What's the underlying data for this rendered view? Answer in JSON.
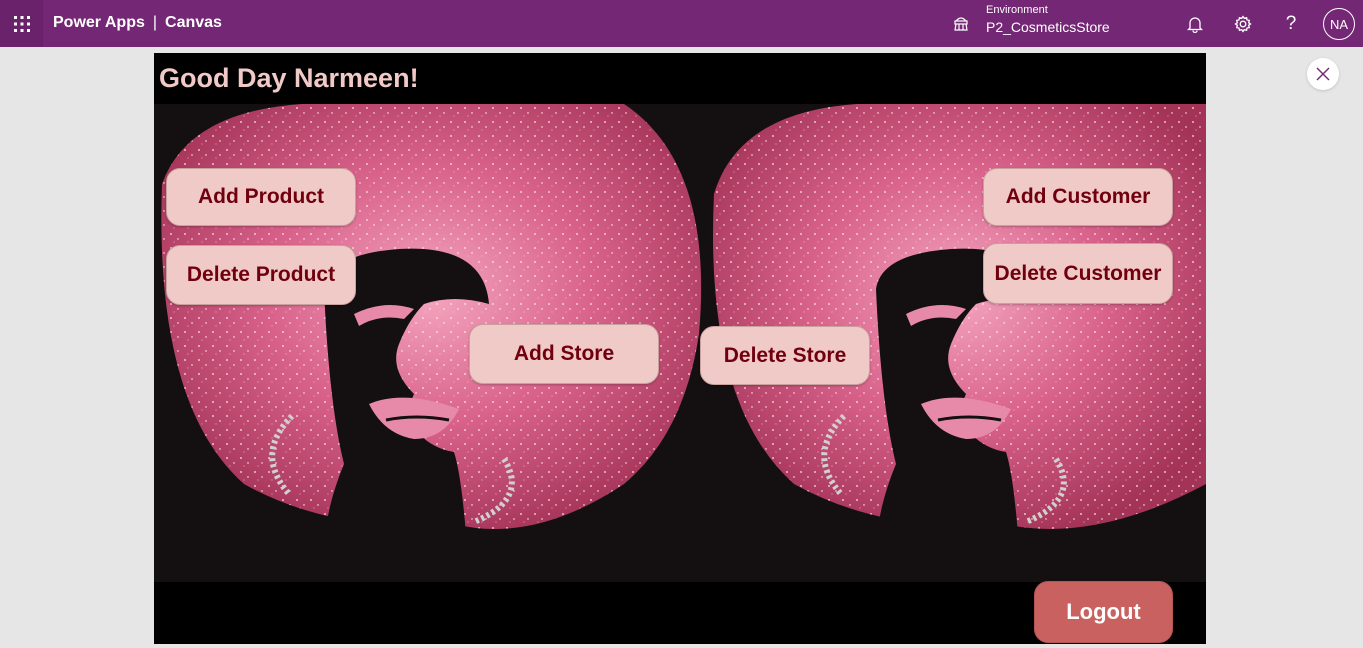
{
  "topbar": {
    "app_name": "Power Apps",
    "separator": "|",
    "section": "Canvas",
    "environment_label": "Environment",
    "environment_name": "P2_CosmeticsStore",
    "help_glyph": "?",
    "avatar_initials": "NA",
    "icons": [
      "app-launcher-icon",
      "environment-icon",
      "bell-icon",
      "gear-icon",
      "help-icon"
    ],
    "color": "#742774"
  },
  "canvas": {
    "greeting": "Good Day Narmeen!",
    "background_image": "pink-glitter-afro-woman-silhouette",
    "buttons": {
      "add_product": "Add Product",
      "delete_product": "Delete Product",
      "add_store": "Add Store",
      "delete_store": "Delete Store",
      "add_customer": "Add Customer",
      "delete_customer": "Delete Customer",
      "logout": "Logout"
    },
    "colors": {
      "greeting_text": "#f1c9c6",
      "button_fill": "#f0cac7",
      "button_text": "#70000f",
      "logout_fill": "#c8615f",
      "frame": "#000000"
    }
  }
}
